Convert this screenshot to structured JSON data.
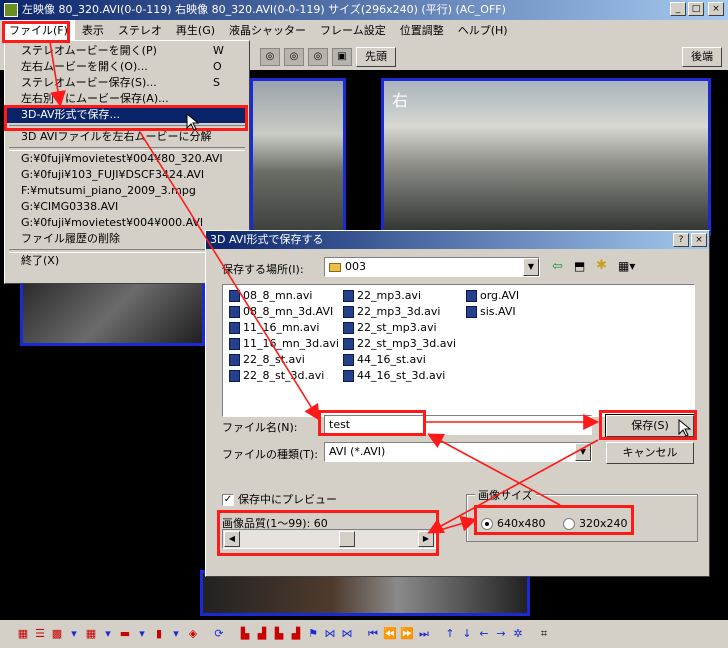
{
  "window": {
    "title": "左映像 80_320.AVI(0-0-119)  右映像 80_320.AVI(0-0-119) サイズ(296x240) (平行) (AC_OFF)",
    "minimize": "_",
    "maximize": "□",
    "close": "×"
  },
  "menubar": {
    "items": [
      "ファイル(F)",
      "表示",
      "ステレオ",
      "再生(G)",
      "液晶シャッター",
      "フレーム設定",
      "位置調整",
      "ヘルプ(H)"
    ]
  },
  "file_menu": {
    "items": [
      {
        "label": "ステレオムービーを開く(P)",
        "shortcut": "W"
      },
      {
        "label": "左右ムービーを開く(O)...",
        "shortcut": "O"
      },
      {
        "label": "ステレオムービー保存(S)...",
        "shortcut": "S"
      },
      {
        "label": "左右別々にムービー保存(A)...",
        "shortcut": ""
      },
      {
        "label": "3D-AV形式で保存...",
        "shortcut": ""
      },
      {
        "label": "3D AVIファイルを左右ムービーに分解",
        "shortcut": ""
      },
      {
        "label": "G:¥0fuji¥movietest¥004¥80_320.AVI",
        "shortcut": ""
      },
      {
        "label": "G:¥0fuji¥103_FUJI¥DSCF3424.AVI",
        "shortcut": ""
      },
      {
        "label": "F:¥mutsumi_piano_2009_3.mpg",
        "shortcut": ""
      },
      {
        "label": "G:¥CIMG0338.AVI",
        "shortcut": ""
      },
      {
        "label": "G:¥0fuji¥movietest¥004¥000.AVI",
        "shortcut": ""
      },
      {
        "label": "ファイル履歴の削除",
        "shortcut": ""
      },
      {
        "label": "終了(X)",
        "shortcut": ""
      }
    ]
  },
  "view_toolbar": {
    "first_label": "先頭",
    "last_label": "後端"
  },
  "viewer": {
    "right_label": "右"
  },
  "dialog": {
    "title": "3D AVI形式で保存する",
    "help": "?",
    "close": "×",
    "save_in_label": "保存する場所(I):",
    "save_in_value": "003",
    "files": [
      [
        "08_8_mn.avi",
        "08_8_mn_3d.AVI",
        "11_16_mn.avi",
        "11_16_mn_3d.avi",
        "22_8_st.avi",
        "22_8_st_3d.avi"
      ],
      [
        "22_mp3.avi",
        "22_mp3_3d.avi",
        "22_st_mp3.avi",
        "22_st_mp3_3d.avi",
        "44_16_st.avi",
        "44_16_st_3d.avi"
      ],
      [
        "org.AVI",
        "sis.AVI"
      ]
    ],
    "filename_label": "ファイル名(N):",
    "filename_value": "test",
    "filetype_label": "ファイルの種類(T):",
    "filetype_value": "AVI (*.AVI)",
    "save_button": "保存(S)",
    "cancel_button": "キャンセル",
    "preview_label": "保存中にプレビュー",
    "quality_label": "画像品質(1〜99):  60",
    "quality_value": 60,
    "quality_min": 1,
    "quality_max": 99,
    "size_group_label": "画像サイズ",
    "size_options": [
      "640x480",
      "320x240"
    ],
    "size_selected": "640x480"
  },
  "colors": {
    "title_active": "#0a246a",
    "annotation": "#ff1a1a",
    "frame_border": "#1a2bd6"
  }
}
